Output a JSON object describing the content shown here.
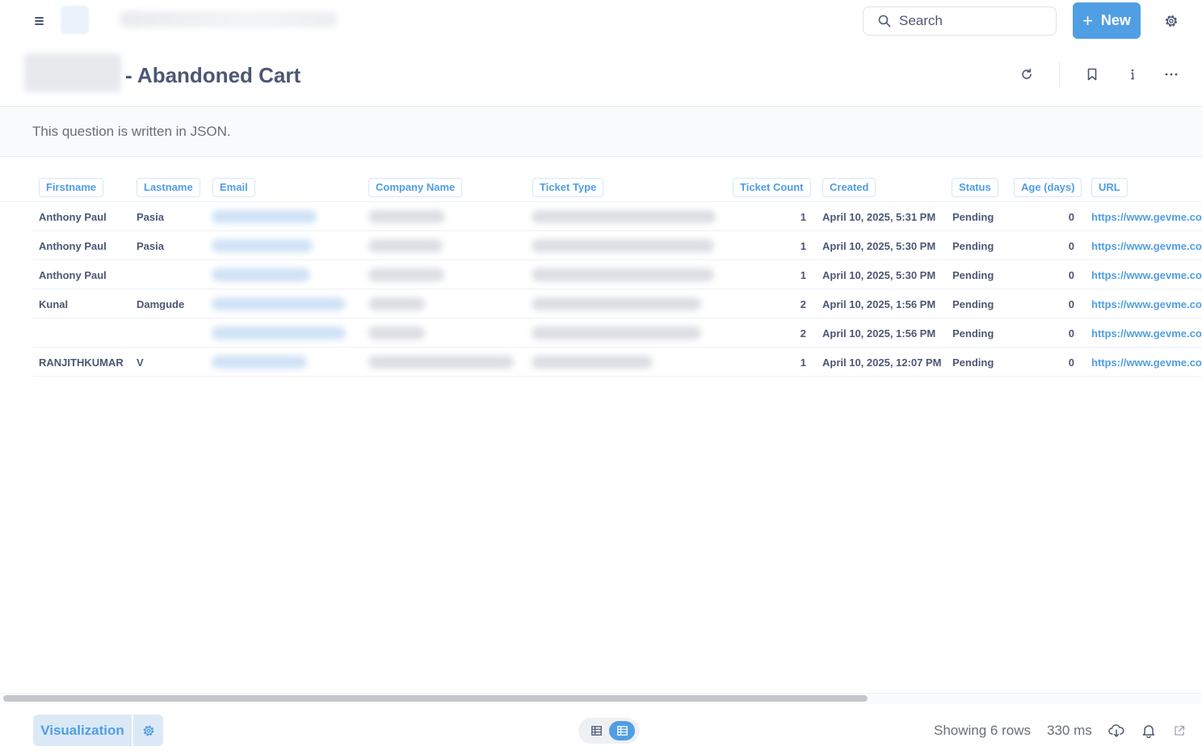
{
  "header": {
    "search_label": "Search",
    "new_label": "New",
    "question_title": "- Abandoned Cart",
    "notice": "This question is written in JSON."
  },
  "table": {
    "columns": [
      "Firstname",
      "Lastname",
      "Email",
      "Company Name",
      "Ticket Type",
      "Ticket Count",
      "Created",
      "Status",
      "Age (days)",
      "URL"
    ],
    "rows": [
      {
        "firstname": "Anthony Paul",
        "lastname": "Pasia",
        "ticket_count": "1",
        "created": "April 10, 2025, 5:31 PM",
        "status": "Pending",
        "age": "0",
        "url": "https://www.gevme.com"
      },
      {
        "firstname": "Anthony Paul",
        "lastname": "Pasia",
        "ticket_count": "1",
        "created": "April 10, 2025, 5:30 PM",
        "status": "Pending",
        "age": "0",
        "url": "https://www.gevme.com"
      },
      {
        "firstname": "Anthony Paul",
        "lastname": "",
        "ticket_count": "1",
        "created": "April 10, 2025, 5:30 PM",
        "status": "Pending",
        "age": "0",
        "url": "https://www.gevme.com"
      },
      {
        "firstname": "Kunal",
        "lastname": "Damgude",
        "ticket_count": "2",
        "created": "April 10, 2025, 1:56 PM",
        "status": "Pending",
        "age": "0",
        "url": "https://www.gevme.com"
      },
      {
        "firstname": "",
        "lastname": "",
        "ticket_count": "2",
        "created": "April 10, 2025, 1:56 PM",
        "status": "Pending",
        "age": "0",
        "url": "https://www.gevme.com"
      },
      {
        "firstname": "RANJITHKUMAR",
        "lastname": "V",
        "ticket_count": "1",
        "created": "April 10, 2025, 12:07 PM",
        "status": "Pending",
        "age": "0",
        "url": "https://www.gevme.com"
      }
    ]
  },
  "footer": {
    "visualization_label": "Visualization",
    "row_count": "Showing 6 rows",
    "timing": "330 ms"
  },
  "colors": {
    "brand": "#509ee3",
    "text": "#4c5773",
    "muted": "#696e7b"
  }
}
